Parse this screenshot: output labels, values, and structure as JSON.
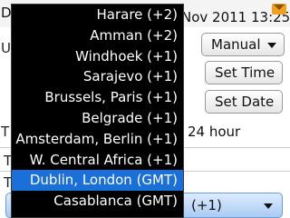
{
  "header": {
    "title_initial": "D",
    "datetime": "Nov 2011 13:25"
  },
  "background": {
    "row1_letter": "U",
    "update_mode_value": "Manual",
    "set_time_label": "Set Time",
    "set_date_label": "Set Date",
    "row4_letter": "T",
    "time_format_value": "24 hour",
    "row5_letter": "T",
    "row6_letter": "T",
    "time_zone_offset": "(+1)"
  },
  "timezone_dropdown": {
    "items": [
      {
        "label": "Harare (+2)"
      },
      {
        "label": "Amman (+2)"
      },
      {
        "label": "Windhoek (+1)"
      },
      {
        "label": "Sarajevo (+1)"
      },
      {
        "label": "Brussels, Paris (+1)"
      },
      {
        "label": "Belgrade (+1)"
      },
      {
        "label": "Amsterdam, Berlin (+1)"
      },
      {
        "label": "W. Central Africa (+1)"
      },
      {
        "label": "Dublin, London (GMT)"
      },
      {
        "label": "Casablanca (GMT)"
      }
    ],
    "selected": "Dublin, London (GMT)"
  },
  "colors": {
    "selection": "#1a6fd8",
    "popup_background": "#000000",
    "accent": "#f0a020"
  }
}
